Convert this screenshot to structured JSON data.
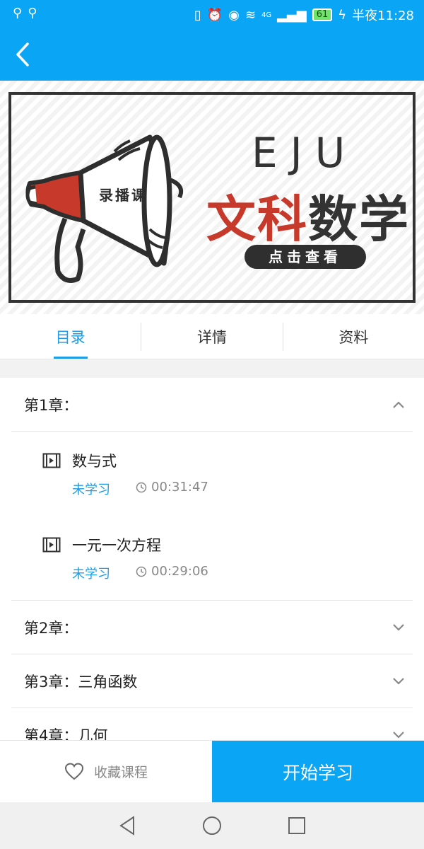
{
  "status_bar": {
    "left_icons": [
      "usb-icon",
      "usb-icon"
    ],
    "battery": "61",
    "network": "4G",
    "time": "半夜11:28"
  },
  "banner": {
    "badge": "录播课",
    "brand": "EJU",
    "subject_part1": "文科",
    "subject_part2": "数学",
    "cta": "点击查看",
    "colors": {
      "red": "#c73a2b",
      "dark": "#333333"
    }
  },
  "tabs": [
    {
      "label": "目录",
      "active": true
    },
    {
      "label": "详情",
      "active": false
    },
    {
      "label": "资料",
      "active": false
    }
  ],
  "chapters": [
    {
      "title": "第1章：",
      "expanded": true,
      "lessons": [
        {
          "name": "数与式",
          "status": "未学习",
          "duration": "00:31:47"
        },
        {
          "name": "一元一次方程",
          "status": "未学习",
          "duration": "00:29:06"
        }
      ]
    },
    {
      "title": "第2章：",
      "expanded": false
    },
    {
      "title": "第3章：三角函数",
      "expanded": false
    },
    {
      "title": "第4章：几何",
      "expanded": false
    }
  ],
  "bottom": {
    "favorite_label": "收藏课程",
    "start_label": "开始学习"
  },
  "accent": "#0aa6f5"
}
